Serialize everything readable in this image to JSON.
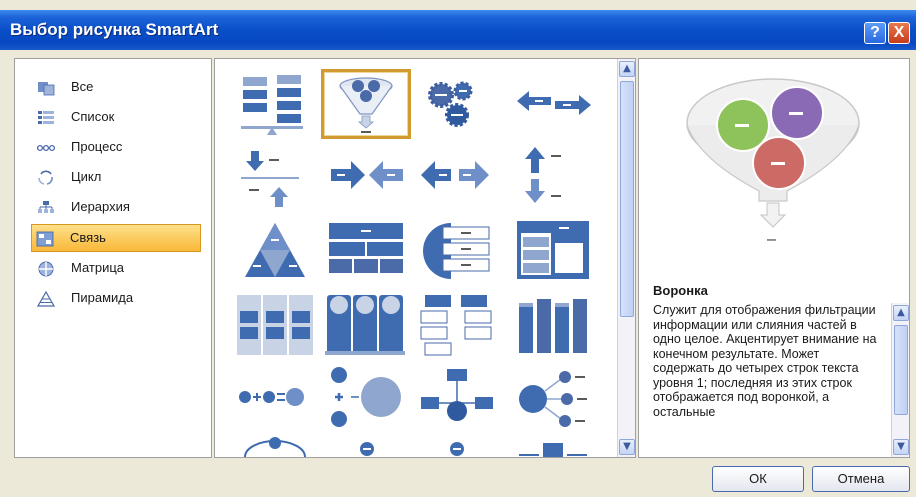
{
  "window": {
    "title": "Выбор рисунка SmartArt",
    "help_label": "?",
    "close_label": "X"
  },
  "categories": [
    {
      "label": "Все",
      "icon": "all-icon"
    },
    {
      "label": "Список",
      "icon": "list-icon"
    },
    {
      "label": "Процесс",
      "icon": "process-icon"
    },
    {
      "label": "Цикл",
      "icon": "cycle-icon"
    },
    {
      "label": "Иерархия",
      "icon": "hierarchy-icon"
    },
    {
      "label": "Связь",
      "icon": "relationship-icon",
      "selected": true
    },
    {
      "label": "Матрица",
      "icon": "matrix-icon"
    },
    {
      "label": "Пирамида",
      "icon": "pyramid-icon"
    }
  ],
  "grid": {
    "selected": "funnel",
    "items": [
      {
        "name": "balance"
      },
      {
        "name": "funnel"
      },
      {
        "name": "gears"
      },
      {
        "name": "opposing-arrows"
      },
      {
        "name": "counterbalance-arrows"
      },
      {
        "name": "converging-arrows"
      },
      {
        "name": "diverging-arrows"
      },
      {
        "name": "opposing-up-down-arrows"
      },
      {
        "name": "segmented-pyramid"
      },
      {
        "name": "table-hierarchy"
      },
      {
        "name": "arc-list"
      },
      {
        "name": "nested-target-list"
      },
      {
        "name": "grouped-list"
      },
      {
        "name": "circle-list"
      },
      {
        "name": "hierarchy-list"
      },
      {
        "name": "vertical-bars"
      },
      {
        "name": "equation"
      },
      {
        "name": "plus-circle"
      },
      {
        "name": "tree-relationship"
      },
      {
        "name": "radial-list"
      },
      {
        "name": "arc-row"
      },
      {
        "name": "bullet-row-1"
      },
      {
        "name": "bullet-row-2"
      },
      {
        "name": "bracket-row"
      }
    ]
  },
  "preview": {
    "title": "Воронка",
    "description": "Служит для отображения фильтрации информации или слияния частей в одно целое. Акцентирует внимание на конечном результате. Может содержать до четырех строк текста уровня 1; последняя из этих строк отображается под воронкой, а остальные",
    "placeholder_dash": "–",
    "colors": {
      "green": "#8ec25a",
      "purple": "#8a6ab4",
      "red": "#cc6a66"
    }
  },
  "buttons": {
    "ok": "ОК",
    "cancel": "Отмена"
  },
  "colors": {
    "titlebar": "#0a4fc8",
    "selection_highlight": "#f8c04a",
    "diagram_blue": "#3f6cb0"
  }
}
